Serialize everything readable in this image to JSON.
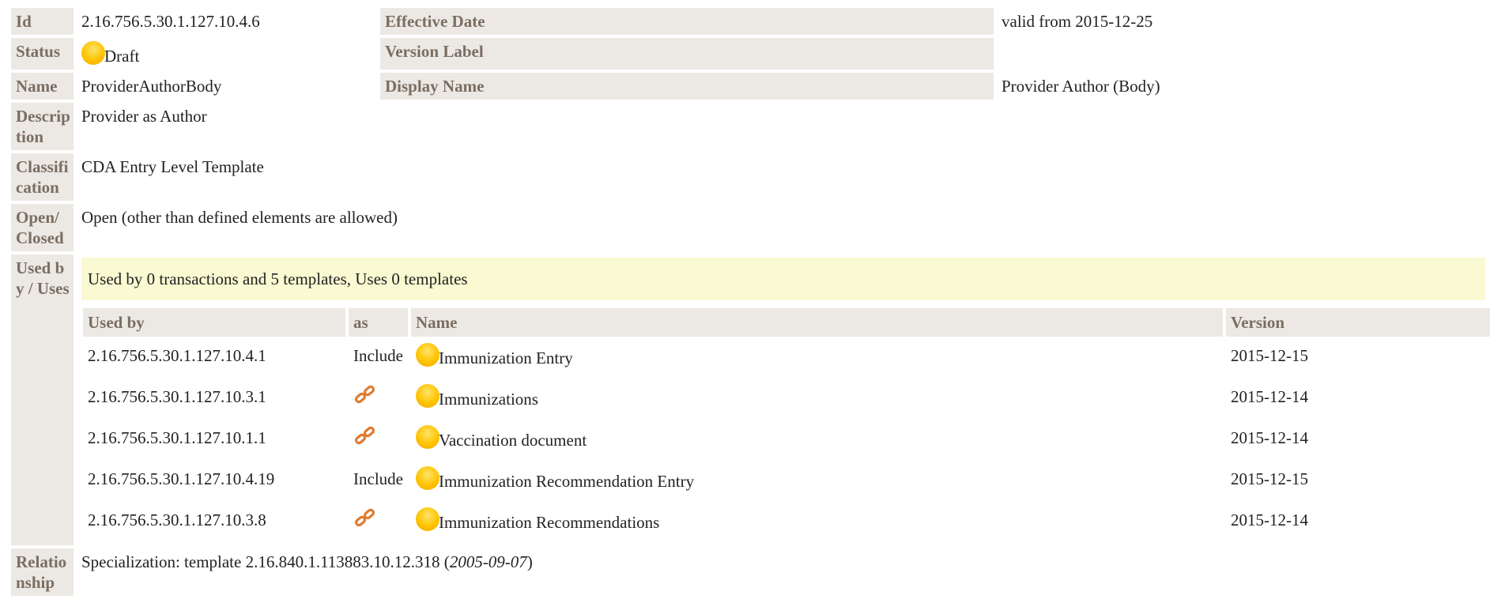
{
  "rows": {
    "id": {
      "label": "Id",
      "value": "2.16.756.5.30.1.127.10.4.6"
    },
    "effective_date": {
      "label": "Effective Date",
      "value": "valid from 2015-12-25"
    },
    "status": {
      "label": "Status",
      "value": "Draft"
    },
    "version_label": {
      "label": "Version Label",
      "value": ""
    },
    "name": {
      "label": "Name",
      "value": "ProviderAuthorBody"
    },
    "display_name": {
      "label": "Display Name",
      "value": "Provider Author (Body)"
    },
    "description": {
      "label": "Description",
      "value": "Provider as Author"
    },
    "classification": {
      "label": "Classification",
      "value": "CDA Entry Level Template"
    },
    "open_closed": {
      "label": "Open/Closed",
      "value": "Open (other than defined elements are allowed)"
    },
    "used_by_uses": {
      "label": "Used by / Uses",
      "summary": "Used by 0 transactions and 5 templates, Uses 0 templates"
    },
    "relationship": {
      "label": "Relationship",
      "prefix": "Specialization: template 2.16.840.1.113883.10.12.318 (",
      "date": "2005-09-07",
      "suffix": ")"
    }
  },
  "uses_table": {
    "headers": {
      "used_by": "Used by",
      "as": "as",
      "name": "Name",
      "version": "Version"
    },
    "rows": [
      {
        "id": "2.16.756.5.30.1.127.10.4.1",
        "as": "Include",
        "name": "Immunization Entry",
        "version": "2015-12-15"
      },
      {
        "id": "2.16.756.5.30.1.127.10.3.1",
        "as": "",
        "name": "Immunizations",
        "version": "2015-12-14"
      },
      {
        "id": "2.16.756.5.30.1.127.10.1.1",
        "as": "",
        "name": "Vaccination document",
        "version": "2015-12-14"
      },
      {
        "id": "2.16.756.5.30.1.127.10.4.19",
        "as": "Include",
        "name": "Immunization Recommendation Entry",
        "version": "2015-12-15"
      },
      {
        "id": "2.16.756.5.30.1.127.10.3.8",
        "as": "",
        "name": "Immunization Recommendations",
        "version": "2015-12-14"
      }
    ]
  },
  "icons": {
    "status_dot": "status-draft-dot-icon",
    "link": "containment-link-icon"
  },
  "colors": {
    "label_bg": "#ece8e4",
    "label_text": "#7a6e62",
    "banner_bg": "#f9f9d2",
    "dot": "#ffc400",
    "link": "#e07a2e"
  }
}
